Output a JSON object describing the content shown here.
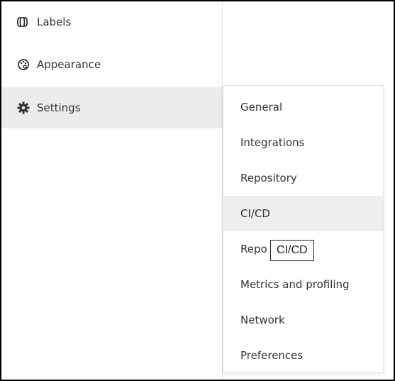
{
  "sidebar": {
    "items": [
      {
        "label": "Labels",
        "icon": "labels-icon"
      },
      {
        "label": "Appearance",
        "icon": "palette-icon"
      },
      {
        "label": "Settings",
        "icon": "gear-icon",
        "active": true
      }
    ]
  },
  "settings_menu": {
    "items": [
      {
        "label": "General"
      },
      {
        "label": "Integrations"
      },
      {
        "label": "Repository"
      },
      {
        "label": "CI/CD",
        "hovered": true
      },
      {
        "label": "Repo"
      },
      {
        "label": "Metrics and profiling"
      },
      {
        "label": "Network"
      },
      {
        "label": "Preferences"
      }
    ]
  },
  "tooltip": {
    "text": "CI/CD"
  },
  "colors": {
    "active_bg": "#ececec",
    "hover_bg": "#eeeeee",
    "text": "#333333",
    "border": "#000000"
  }
}
